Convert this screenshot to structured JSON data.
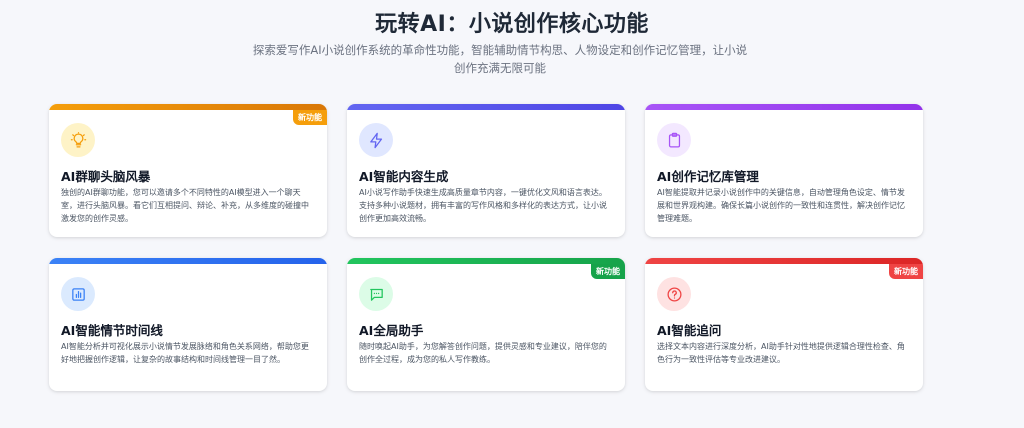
{
  "header": {
    "title": "玩转AI：小说创作核心功能",
    "subtitle": "探索爱写作AI小说创作系统的革命性功能，智能辅助情节构思、人物设定和创作记忆管理，让小说创作充满无限可能"
  },
  "cards": [
    {
      "title": "AI群聊头脑风暴",
      "desc": "独创的AI群聊功能，您可以邀请多个不同特性的AI模型进入一个聊天室，进行头脑风暴。看它们互相提问、辩论、补充，从多维度的碰撞中激发您的创作灵感。",
      "badge": "新功能",
      "icon": "lightbulb-icon",
      "color": "#f59e0b"
    },
    {
      "title": "AI智能内容生成",
      "desc": "AI小说写作助手快速生成高质量章节内容，一键优化文风和语言表达。支持多种小说题材，拥有丰富的写作风格和多样化的表达方式，让小说创作更加高效流畅。",
      "badge": "",
      "icon": "lightning-icon",
      "color": "#6366f1"
    },
    {
      "title": "AI创作记忆库管理",
      "desc": "AI智能提取并记录小说创作中的关键信息，自动管理角色设定、情节发展和世界观构建。确保长篇小说创作的一致性和连贯性，解决创作记忆管理难题。",
      "badge": "",
      "icon": "clipboard-icon",
      "color": "#a855f7"
    },
    {
      "title": "AI智能情节时间线",
      "desc": "AI智能分析并可视化展示小说情节发展脉络和角色关系网络，帮助您更好地把握创作逻辑，让复杂的故事结构和时间线管理一目了然。",
      "badge": "",
      "icon": "bar-chart-icon",
      "color": "#3b82f6"
    },
    {
      "title": "AI全局助手",
      "desc": "随时唤起AI助手，为您解答创作问题，提供灵感和专业建议，陪伴您的创作全过程，成为您的私人写作教练。",
      "badge": "新功能",
      "icon": "chat-icon",
      "color": "#22c55e"
    },
    {
      "title": "AI智能追问",
      "desc": "选择文本内容进行深度分析，AI助手针对性地提供逻辑合理性检查、角色行为一致性评估等专业改进建议。",
      "badge": "新功能",
      "icon": "question-icon",
      "color": "#ef4444"
    }
  ]
}
